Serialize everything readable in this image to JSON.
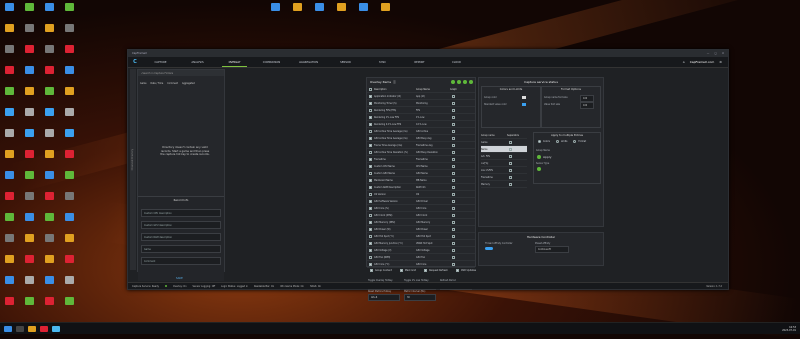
{
  "window": {
    "title": "CapFrameX",
    "tabs": [
      "CAPTURE",
      "ANALYSIS",
      "OVERLAY",
      "COMPARISON",
      "AGGREGATION",
      "SENSOR",
      "SYNC",
      "REPORT",
      "CLOUD"
    ],
    "active_tab": "OVERLAY",
    "brand": "CapFrameX.com"
  },
  "left": {
    "search_placeholder": "Search in Capture Folders",
    "columns": [
      "Game",
      "Date / Time",
      "Comment",
      "Aggregated"
    ],
    "empty_message": "Directory doesn't contain any valid records. Start a game and then press the capture hot key to create records.",
    "side_label": "Observed Directory"
  },
  "record_info": {
    "title": "Record Info",
    "fields": [
      "Custom CPU description",
      "Custom GPU description",
      "Custom RAM description",
      "Game",
      "Comment"
    ],
    "save_label": "SAVE"
  },
  "overlay": {
    "title": "Overlay Items",
    "columns": [
      "Description",
      "Group Name",
      "Graph"
    ],
    "items": [
      [
        "Application Indicator (Id)",
        "App (Id)"
      ],
      [
        "Monitoring Timer (S)",
        "Monitoring"
      ],
      [
        "Rendering FPS (FPS)",
        "FPS"
      ],
      [
        "Rendering 1% Low FPS",
        "1% Low"
      ],
      [
        "Rendering 0.1% Low FPS",
        "0.1% Low"
      ],
      [
        "GPU Active Time Average (ms)",
        "GPU Active"
      ],
      [
        "GPU Active Time Average (ms)",
        "GPU Busy Avg"
      ],
      [
        "Frame Time Average (ms)",
        "Frametime Avg"
      ],
      [
        "GPU Active Time Deviation (%)",
        "GPU Busy Deviation"
      ],
      [
        "Frametime",
        "Frametime"
      ],
      [
        "Custom CPU Name",
        "CPU Name"
      ],
      [
        "Custom GPU Name",
        "GPU Name"
      ],
      [
        "Mainboard Name",
        "MB Name"
      ],
      [
        "Custom RAM Description",
        "RAM Info"
      ],
      [
        "OS Version",
        "OS"
      ],
      [
        "GPU Software Version",
        "GPU Driver"
      ],
      [
        "GPU Core (%)",
        "GPU Core"
      ],
      [
        "GPU Clock (MHz)",
        "GPU Clock"
      ],
      [
        "GPU Memory (MHz)",
        "GPU Memory"
      ],
      [
        "GPU Power (W)",
        "GPU Power"
      ],
      [
        "GPU Hot Spot (°C)",
        "GPU Hot Spot"
      ],
      [
        "GPU Memory Junction (°C)",
        "VRAM Hot Spot"
      ],
      [
        "GPU Voltage (V)",
        "GPU Voltage"
      ],
      [
        "GPU Fan (RPM)",
        "GPU Fan"
      ],
      [
        "GPU Core (°C)",
        "GPU Core"
      ]
    ],
    "group_checks": [
      "Group Content",
      "Mark Grid",
      "Request Refresh",
      "OSD Updates"
    ],
    "settings": [
      {
        "label": "Toggle Overlay Hotkey",
        "value": "Alt+O"
      },
      {
        "label": "Toggle 1% Low Hotkey",
        "value": "Alt+L"
      },
      {
        "label": "Refresh Period",
        "value": "500"
      },
      {
        "label": "Reset Metrics Hotkey",
        "value": "Alt+R"
      },
      {
        "label": "Metric Interval (Ms)",
        "value": "30"
      }
    ]
  },
  "capture_status": {
    "title": "Capture service status",
    "colors_limits": "Colors and Limits",
    "group_color": "Group color",
    "value_color": "Standard value color",
    "format_options": "Format Options",
    "format_rows": [
      {
        "label": "Group name font size",
        "value": "100"
      },
      {
        "label": "Value font size",
        "value": "100"
      }
    ],
    "group_table_cols": [
      "Group name",
      "Separators"
    ],
    "group_rows": [
      "Game",
      "Name",
      "Act. FPS",
      "cur[%]",
      "low 1%FPS",
      "Frametime",
      "Memory"
    ],
    "apply_title": "Apply to multiple Entries",
    "apply_options": [
      "Colors",
      "Limits",
      "Format"
    ],
    "group_name_label": "Group Name",
    "apply_button": "Apply",
    "sensor_type": "Sensor Type"
  },
  "hardware": {
    "title": "Hardware Controller",
    "thread_affinity": "Thread Affinity Controller",
    "preset_label": "Preset Affinity",
    "preset_value": "Continue-fit"
  },
  "statusbar": {
    "capture_service": "Capture Service: Ready",
    "overlay": "Overlay: On",
    "sensor_logging": "Sensor Logging: Off",
    "logic_status": "Logic Status: Logged in",
    "resizable_bar": "Resizable Bar: On",
    "min_overall_note": "Win Game Mode: On",
    "hags": "HAGS: On",
    "version": "Version: 1.7.2"
  },
  "taskbar": {
    "time": "16:53",
    "date": "2023-07-01"
  }
}
